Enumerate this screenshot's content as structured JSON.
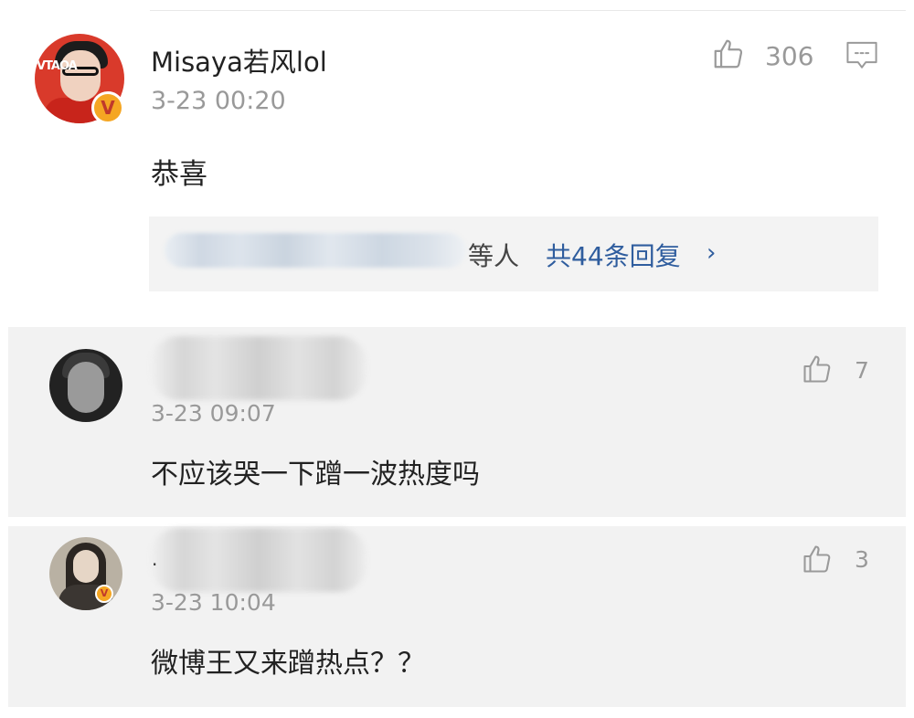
{
  "main_comment": {
    "username": "Misaya若风lol",
    "time": "3-23 00:20",
    "likes": "306",
    "text": "恭喜",
    "verified": true,
    "replies": {
      "etc_label": "等人",
      "link_label": "共44条回复",
      "chevron": "›"
    }
  },
  "sub_comments": [
    {
      "time": "3-23 09:07",
      "likes": "7",
      "text": "不应该哭一下蹭一波热度吗"
    },
    {
      "time": "3-23 10:04",
      "likes": "3",
      "text": "微博王又来蹭热点？？",
      "verified": true,
      "username_prefix": "."
    }
  ],
  "colors": {
    "accent_link": "#2f5d9e",
    "meta_gray": "#999999",
    "panel_bg": "#f2f2f2",
    "verified_badge": "#f5a623"
  },
  "icons": {
    "like": "thumbs-up-icon",
    "comment": "comment-bubble-icon",
    "verified": "verified-v-badge-icon"
  }
}
